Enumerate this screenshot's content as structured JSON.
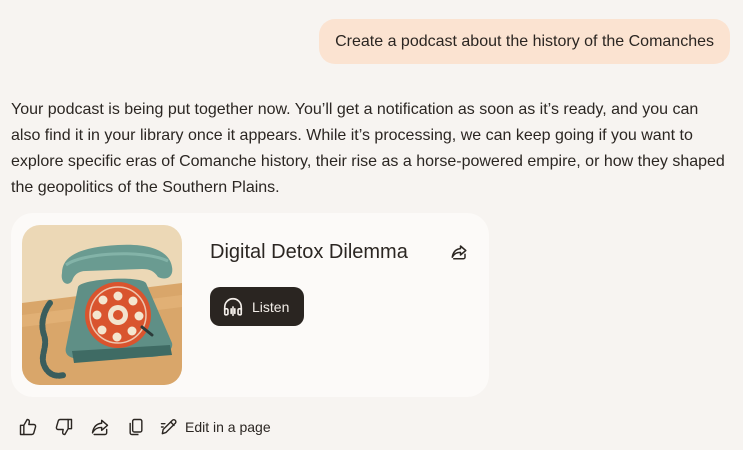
{
  "user_message": "Create a podcast about the history of the Comanches",
  "response": "Your podcast is being put together now. You’ll get a notification as soon as it’s ready, and you can also find it in your library once it appears. While it’s processing, we can keep going if you want to explore specific eras of Comanche history, their rise as a horse-powered empire, or how they shaped the geopolitics of the Southern Plains.",
  "podcast": {
    "title": "Digital Detox Dilemma",
    "listen_label": "Listen",
    "cover_icon": "rotary-telephone-illustration",
    "share_icon": "share-icon",
    "headphones_icon": "headphones-icon"
  },
  "actions": {
    "icons": [
      "thumbs-up-icon",
      "thumbs-down-icon",
      "share-icon",
      "copy-icon",
      "edit-pen-icon"
    ],
    "edit_label": "Edit in a page"
  },
  "colors": {
    "background": "#f7f4f1",
    "user_bubble": "#fbe3d1",
    "card": "#fcfaf8",
    "listen_button": "#2a2521",
    "text": "#2b2622"
  }
}
